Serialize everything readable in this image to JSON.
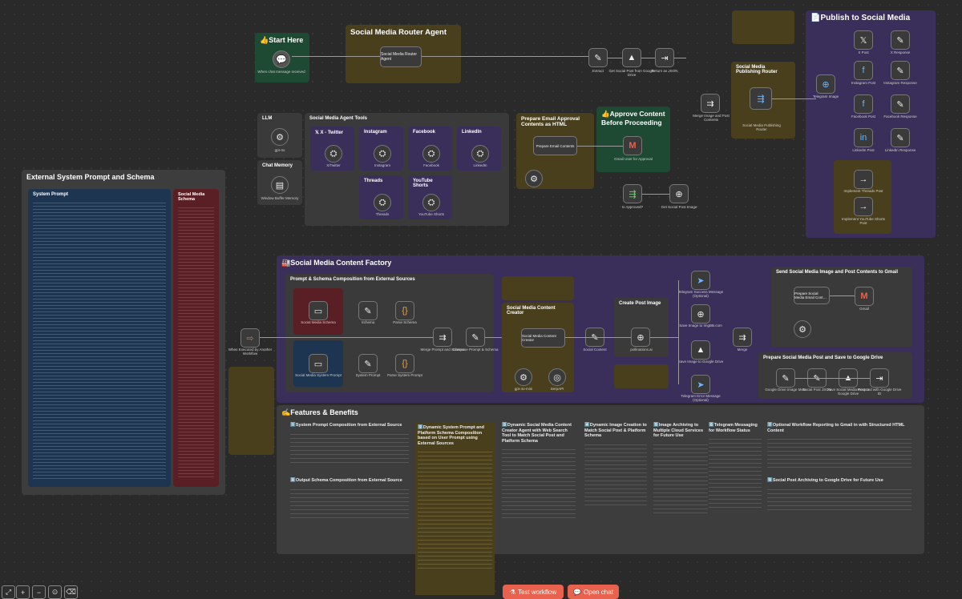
{
  "colors": {
    "canvas": "#2a2a2a",
    "green": "#1e4a34",
    "olive": "#4a3f1c",
    "purple": "#3a2f5a",
    "gray": "#3a3a3a",
    "blue": "#1d3550",
    "red": "#5a1f24",
    "accent": "#e8624d"
  },
  "stickies": {
    "start_here": "👍Start Here",
    "router_agent": "Social Media Router Agent",
    "llm": "LLM",
    "chat_memory": "Chat Memory",
    "agent_tools": "Social Media Agent Tools",
    "prepare_email": "Prepare Email Approval Contents as HTML",
    "approve": "👍Approve Content Before Proceeding",
    "publish": "📄Publish to Social Media",
    "publish_router": "Social Media Publishing Router",
    "external": "External System Prompt and Schema",
    "system_prompt": "System Prompt",
    "schema": "Social Media Schema",
    "factory": "🏭Social Media Content Factory",
    "prompt_composition": "Prompt & Schema Composition from External Sources",
    "creator": "Social Media Content Creator",
    "create_image": "Create Post Image",
    "send_gmail": "Send Social Media Image and Post Contents to Gmail",
    "save_drive": "Prepare Social Media Post and Save to Google Drive",
    "features": "✍️Features & Benefits"
  },
  "tools": [
    {
      "label": "𝕏 X - Twitter",
      "node": "X/Twitter"
    },
    {
      "label": "Instagram",
      "node": "Instagram"
    },
    {
      "label": "Facebook",
      "node": "Facebook"
    },
    {
      "label": "LinkedIn",
      "node": "LinkedIn"
    },
    {
      "label": "Threads",
      "node": "Threads"
    },
    {
      "label": "YouTube Shorts",
      "node": "YouTube Shorts"
    }
  ],
  "nodes": {
    "chat_trigger": "When chat message received",
    "router_agent": "Social Media Router Agent",
    "gpt": "gpt-4o",
    "memory": "Window Buffer Memory",
    "extract": "Extract",
    "get_drive": "Get Social Post from Google Drive",
    "return_json": "Return as JSON",
    "email_contents": "Prepare Email Contents",
    "gmail_approval": "Gmail User for Approval",
    "approved": "Is Approved?",
    "get_image": "Get Social Post Image",
    "merge_image": "Merge Image and Post Contents",
    "publishing_router": "Social Media Publishing Router",
    "telegram_image": "Telegram Image",
    "x_post": "X Post",
    "x_response": "X Response",
    "instagram_post": "Instagram Post",
    "instagram_response": "Instagram Response",
    "facebook_post": "Facebook Post",
    "facebook_response": "Facebook Response",
    "linkedin_post": "LinkedIn Post",
    "linkedin_response": "LinkedIn Response",
    "threads_post": "Implement Threads Post",
    "youtube_post": "Implement YouTube Shorts Post",
    "workflow_trigger": "When Executed by Another Workflow",
    "media_schema": "Social Media Schema",
    "schema": "Schema",
    "parse_schema": "Parse Schema",
    "system_prompt_node": "Social Media System Prompt",
    "system_prompt": "System Prompt",
    "parse_prompt": "Parse System Prompt",
    "merge_prompt": "Merge Prompt and Schema",
    "compose": "Compose Prompt & Schema",
    "content_creator": "Social Media Content Creator",
    "gpt2": "gpt-4o-mini",
    "serpapi": "SerpAPI",
    "social_content": "Social Content",
    "pollinations": "pollinations.ai",
    "telegram_success": "Telegram Success Message (Optional)",
    "save_imgbb": "Save Image to ImgBB.com",
    "save_drive": "Save Image to Google Drive",
    "telegram_error": "Telegram Error Message (Optional)",
    "merge": "Merge",
    "prepare_email": "Prepare Social Media Email Cont…",
    "gmail": "Gmail",
    "drive_meta": "Google Drive Image Meta",
    "social_post_json": "Social Post JSON",
    "save_post_drive": "Save Social Media Post to Google Drive",
    "respond": "Respond with Google Drive ID"
  },
  "features": [
    {
      "title": "1️⃣System Prompt Composition from External Source"
    },
    {
      "title": "2️⃣Dynamic System Prompt and Platform Schema Composition based on User Prompt using External Sources"
    },
    {
      "title": "3️⃣Dynamic Social Media Content Creator Agent with Web Search Tool to Match Social Post and Platform Schema"
    },
    {
      "title": "4️⃣Dynamic Image Creation to Match Social Post & Platform Schema"
    },
    {
      "title": "5️⃣Image Archiving to Multiple Cloud Services for Future Use"
    },
    {
      "title": "6️⃣Telegram Messaging for Workflow Status"
    },
    {
      "title": "7️⃣Optional Workflow Reporting to Gmail in with Structured HTML Content"
    },
    {
      "title": "8️⃣Output Schema Composition from External Source"
    },
    {
      "title": "9️⃣Social Post Archiving to Google Drive for Future Use"
    }
  ],
  "controls": {
    "test_workflow": "Test workflow",
    "open_chat": "Open chat"
  }
}
